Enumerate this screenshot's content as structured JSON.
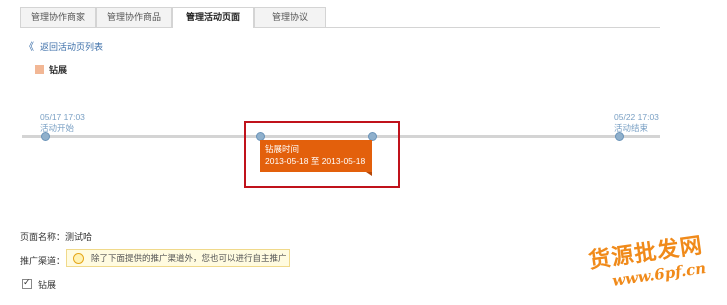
{
  "tabs": [
    {
      "label": "管理协作商家",
      "active": false
    },
    {
      "label": "管理协作商品",
      "active": false
    },
    {
      "label": "管理活动页面",
      "active": true
    },
    {
      "label": "管理协议",
      "active": false
    }
  ],
  "back_link": {
    "icon": "double-chevron-left-icon",
    "label": "返回活动页列表"
  },
  "legend": {
    "label": "钻展",
    "color": "#f2b795"
  },
  "timeline": {
    "start": {
      "date": "05/17 17:03",
      "label": "活动开始"
    },
    "end": {
      "date": "05/22 17:03",
      "label": "活动结束"
    },
    "event": {
      "title": "钻展时间",
      "range": "2013-05-18 至 2013-05-18",
      "color": "#e3600c"
    },
    "highlight_color": "#c0121b"
  },
  "form": {
    "page_name": "页面名称：测试哈",
    "channel_label": "推广渠道：",
    "tip_icon": "lightbulb-icon",
    "tip_text": "除了下面提供的推广渠道外，您也可以进行自主推广",
    "checkbox_label": "钻展",
    "checkbox_checked": true
  },
  "watermark": {
    "text_cn": "货源批发网",
    "url": "www.6pf.cn"
  }
}
